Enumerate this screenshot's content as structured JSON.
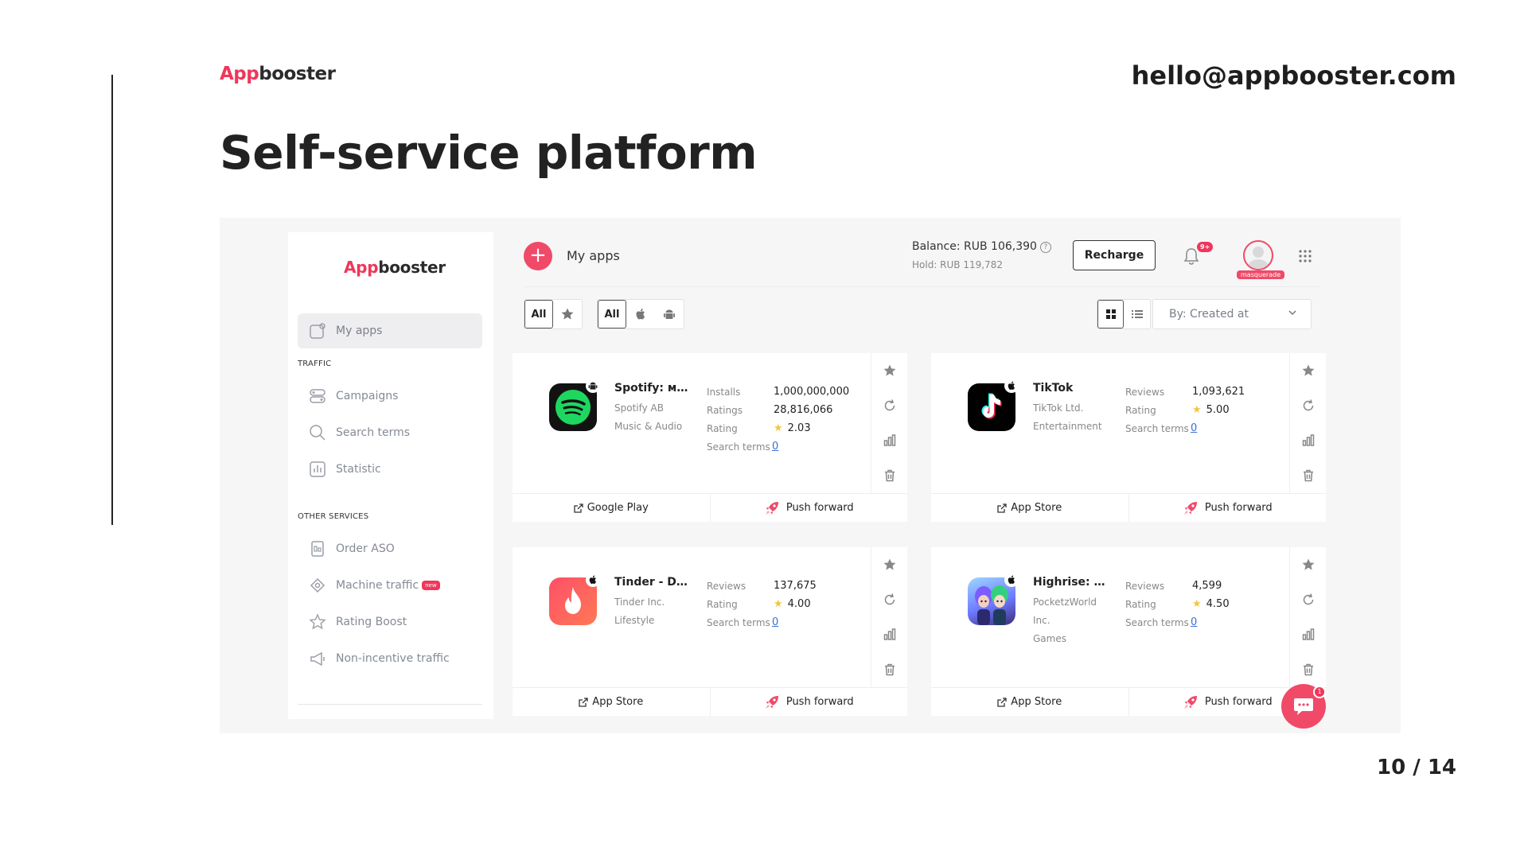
{
  "slide": {
    "logo_app": "App",
    "logo_booster": "booster",
    "email": "hello@appbooster.com",
    "title": "Self-service platform",
    "page_number": "10 / 14"
  },
  "sidebar": {
    "logo_app": "App",
    "logo_booster": "booster",
    "my_apps": "My apps",
    "traffic_section": "TRAFFIC",
    "traffic_items": [
      "Campaigns",
      "Search terms",
      "Statistic"
    ],
    "other_section": "OTHER SERVICES",
    "other_items": [
      "Order ASO",
      "Machine traffic",
      "Rating Boost",
      "Non-incentive traffic"
    ],
    "new_badge": "new"
  },
  "topbar": {
    "add_icon": "+",
    "title": "My apps",
    "balance": "Balance: RUB 106,390",
    "balance_help": "?",
    "hold": "Hold: RUB 119,782",
    "recharge_label": "Recharge",
    "notification_count": "9+",
    "masquerade_label": "masquerade"
  },
  "filters": {
    "all_label_1": "All",
    "all_label_2": "All",
    "sort_label": "By: Created at"
  },
  "cards": [
    {
      "name": "Spotify: муз...",
      "publisher": "Spotify AB",
      "category": "Music & Audio",
      "platform_icon": "android-icon",
      "stats": [
        {
          "label": "Installs",
          "value": "1,000,000,000"
        },
        {
          "label": "Ratings",
          "value": "28,816,066"
        },
        {
          "label": "Rating",
          "value": "2.03"
        },
        {
          "label": "Search terms",
          "value": "0"
        }
      ],
      "store_link": "Google Play",
      "push_label": "Push forward"
    },
    {
      "name": "TikTok",
      "publisher": "TikTok Ltd.",
      "category": "Entertainment",
      "platform_icon": "apple-icon",
      "stats": [
        {
          "label": "Reviews",
          "value": "1,093,621"
        },
        {
          "label": "Rating",
          "value": "5.00"
        },
        {
          "label": "Search terms",
          "value": "0"
        }
      ],
      "store_link": "App Store",
      "push_label": "Push forward"
    },
    {
      "name": "Tinder - Da...",
      "publisher": "Tinder Inc.",
      "category": "Lifestyle",
      "platform_icon": "apple-icon",
      "stats": [
        {
          "label": "Reviews",
          "value": "137,675"
        },
        {
          "label": "Rating",
          "value": "4.00"
        },
        {
          "label": "Search terms",
          "value": "0"
        }
      ],
      "store_link": "App Store",
      "push_label": "Push forward"
    },
    {
      "name": "Highrise: M...",
      "publisher": "PocketzWorld Inc.",
      "category": "Games",
      "platform_icon": "apple-icon",
      "stats": [
        {
          "label": "Reviews",
          "value": "4,599"
        },
        {
          "label": "Rating",
          "value": "4.50"
        },
        {
          "label": "Search terms",
          "value": "0"
        }
      ],
      "store_link": "App Store",
      "push_label": "Push forward"
    }
  ],
  "chat": {
    "badge": "1"
  },
  "colors": {
    "brand": "#f0365a",
    "accent": "#f04a68",
    "link": "#3a6fd8",
    "star": "#f3c63f"
  }
}
